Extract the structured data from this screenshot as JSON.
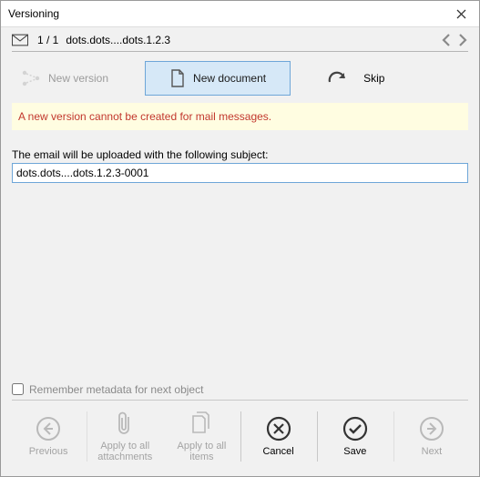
{
  "window": {
    "title": "Versioning"
  },
  "header": {
    "counter": "1 / 1",
    "item_name": "dots.dots....dots.1.2.3"
  },
  "toolbar": {
    "new_version": "New version",
    "new_document": "New document",
    "skip": "Skip"
  },
  "warning": "A new version cannot be created for mail messages.",
  "subject": {
    "label": "The email will be uploaded with the following subject:",
    "value": "dots.dots....dots.1.2.3-0001"
  },
  "remember": {
    "label": "Remember metadata for next object"
  },
  "footer": {
    "previous": "Previous",
    "apply_attachments": "Apply to all\nattachments",
    "apply_items": "Apply to all\nitems",
    "cancel": "Cancel",
    "save": "Save",
    "next": "Next"
  }
}
